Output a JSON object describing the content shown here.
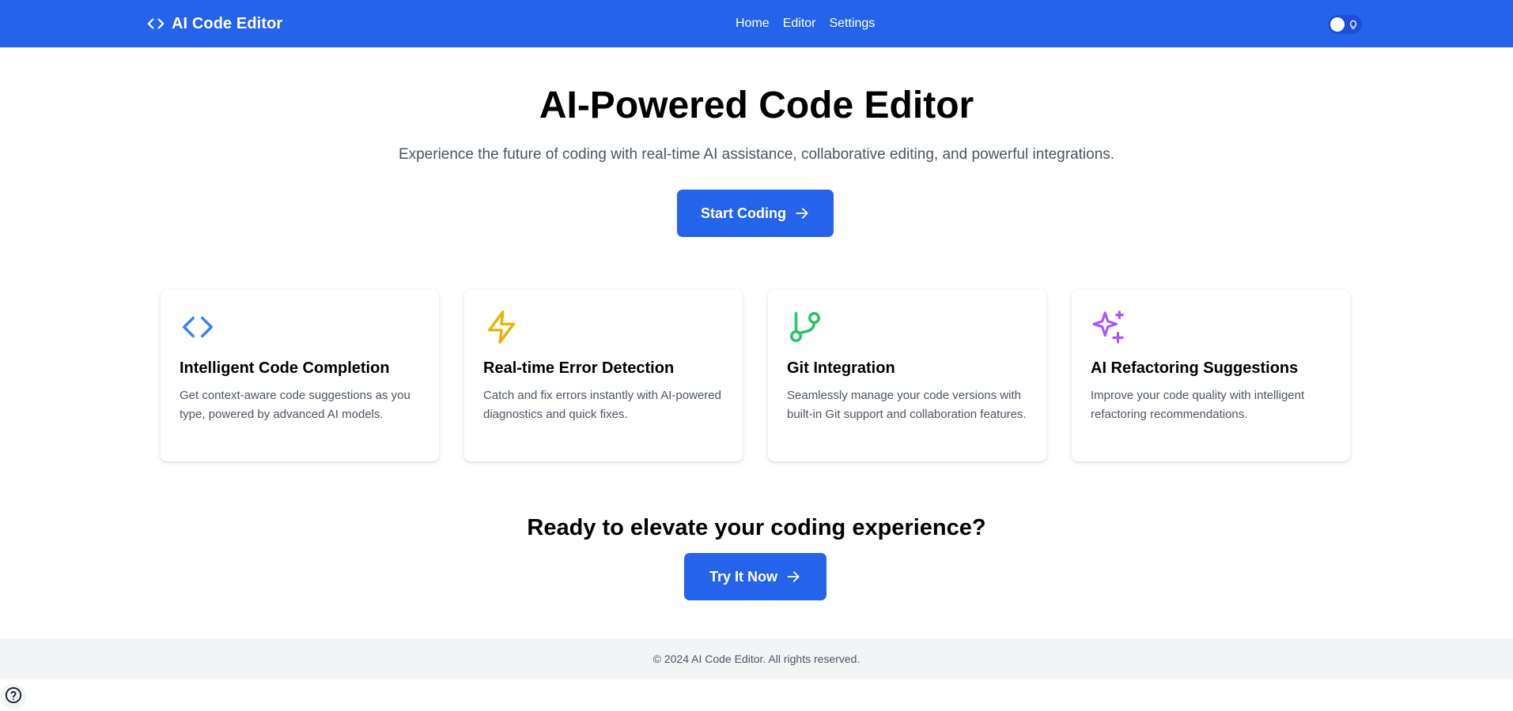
{
  "header": {
    "brand_title": "AI Code Editor",
    "nav": [
      {
        "label": "Home"
      },
      {
        "label": "Editor"
      },
      {
        "label": "Settings"
      }
    ],
    "theme_toggle_icon": "lightbulb-icon"
  },
  "hero": {
    "title": "AI-Powered Code Editor",
    "subtitle": "Experience the future of coding with real-time AI assistance, collaborative editing, and powerful integrations.",
    "cta_label": "Start Coding"
  },
  "features": [
    {
      "icon": "code-brackets-icon",
      "color": "#3b82f6",
      "title": "Intelligent Code Completion",
      "description": "Get context-aware code suggestions as you type, powered by advanced AI models."
    },
    {
      "icon": "lightning-icon",
      "color": "#eab308",
      "title": "Real-time Error Detection",
      "description": "Catch and fix errors instantly with AI-powered diagnostics and quick fixes."
    },
    {
      "icon": "git-branch-icon",
      "color": "#22c55e",
      "title": "Git Integration",
      "description": "Seamlessly manage your code versions with built-in Git support and collaboration features."
    },
    {
      "icon": "sparkles-icon",
      "color": "#a855f7",
      "title": "AI Refactoring Suggestions",
      "description": "Improve your code quality with intelligent refactoring recommendations."
    }
  ],
  "cta": {
    "title": "Ready to elevate your coding experience?",
    "button_label": "Try It Now"
  },
  "footer": {
    "text": "© 2024 AI Code Editor. All rights reserved."
  },
  "colors": {
    "primary": "#2563eb",
    "footer_bg": "#f3f4f6"
  }
}
